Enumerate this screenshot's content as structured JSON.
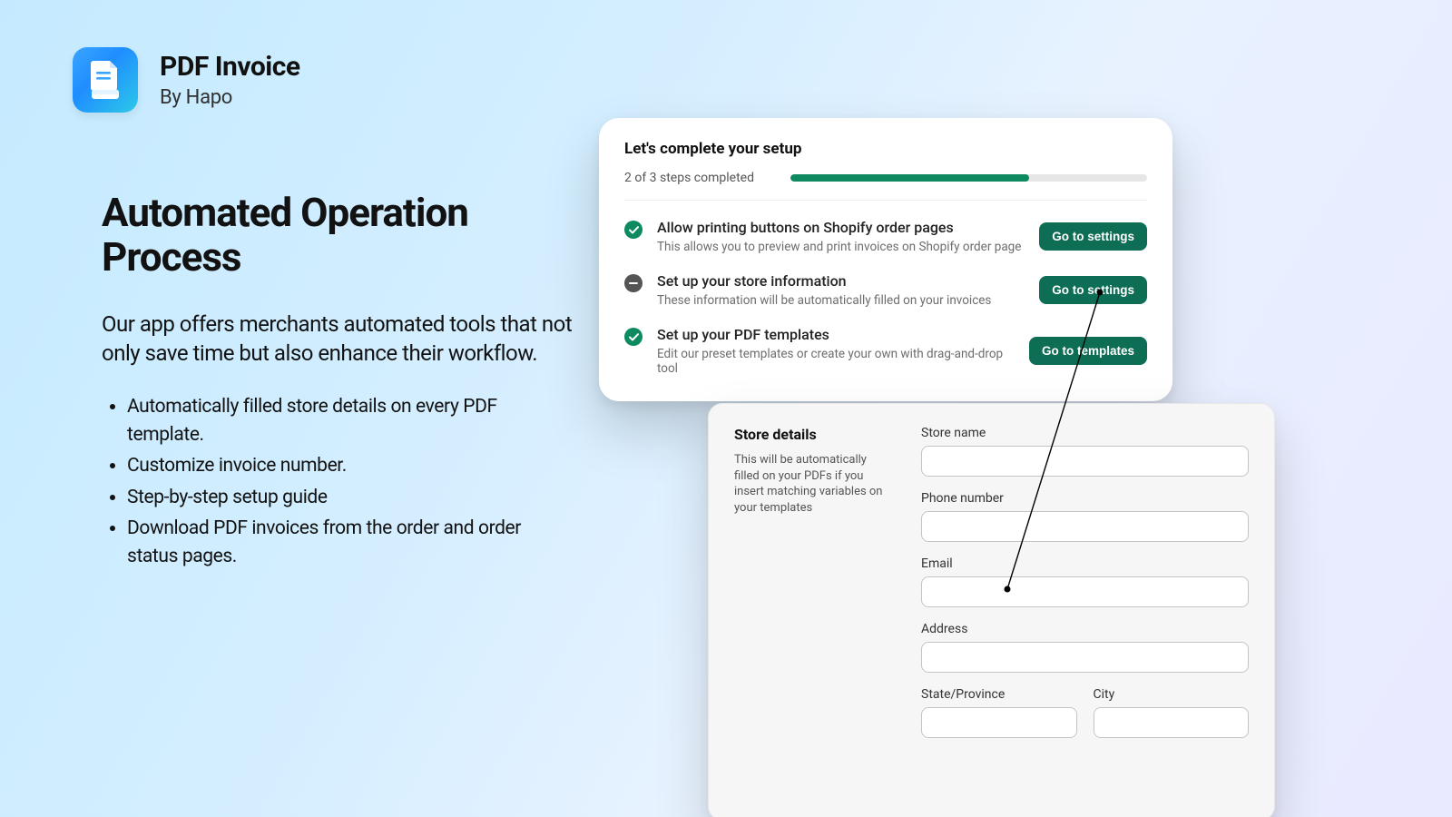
{
  "app": {
    "name": "PDF Invoice",
    "byline": "By Hapo"
  },
  "hero": {
    "heading": "Automated Operation Process",
    "paragraph": "Our app offers merchants automated tools that not only save time but also enhance their workflow.",
    "bullets": [
      "Automatically filled store details on every PDF template.",
      "Customize invoice number.",
      "Step-by-step setup guide",
      "Download PDF invoices from the order and order status pages."
    ]
  },
  "setup": {
    "title": "Let's complete your setup",
    "progress_label": "2 of 3 steps completed",
    "progress_percent": 67,
    "steps": [
      {
        "status": "done",
        "title": "Allow printing buttons on Shopify order pages",
        "desc": "This allows you to preview and print invoices on Shopify order page",
        "button": "Go to settings"
      },
      {
        "status": "pending",
        "title": "Set up your store information",
        "desc": "These information will be automatically filled on your invoices",
        "button": "Go to settings"
      },
      {
        "status": "done",
        "title": "Set up your PDF templates",
        "desc": "Edit our preset templates or create your own with drag-and-drop tool",
        "button": "Go to templates"
      }
    ]
  },
  "details": {
    "heading": "Store details",
    "help": "This will be automatically filled on your PDFs if you insert matching variables on your templates",
    "fields": {
      "store_name_label": "Store name",
      "phone_label": "Phone number",
      "email_label": "Email",
      "address_label": "Address",
      "state_label": "State/Province",
      "city_label": "City"
    }
  },
  "colors": {
    "accent_green": "#0d8a5f",
    "button_green": "#0d6d55"
  }
}
